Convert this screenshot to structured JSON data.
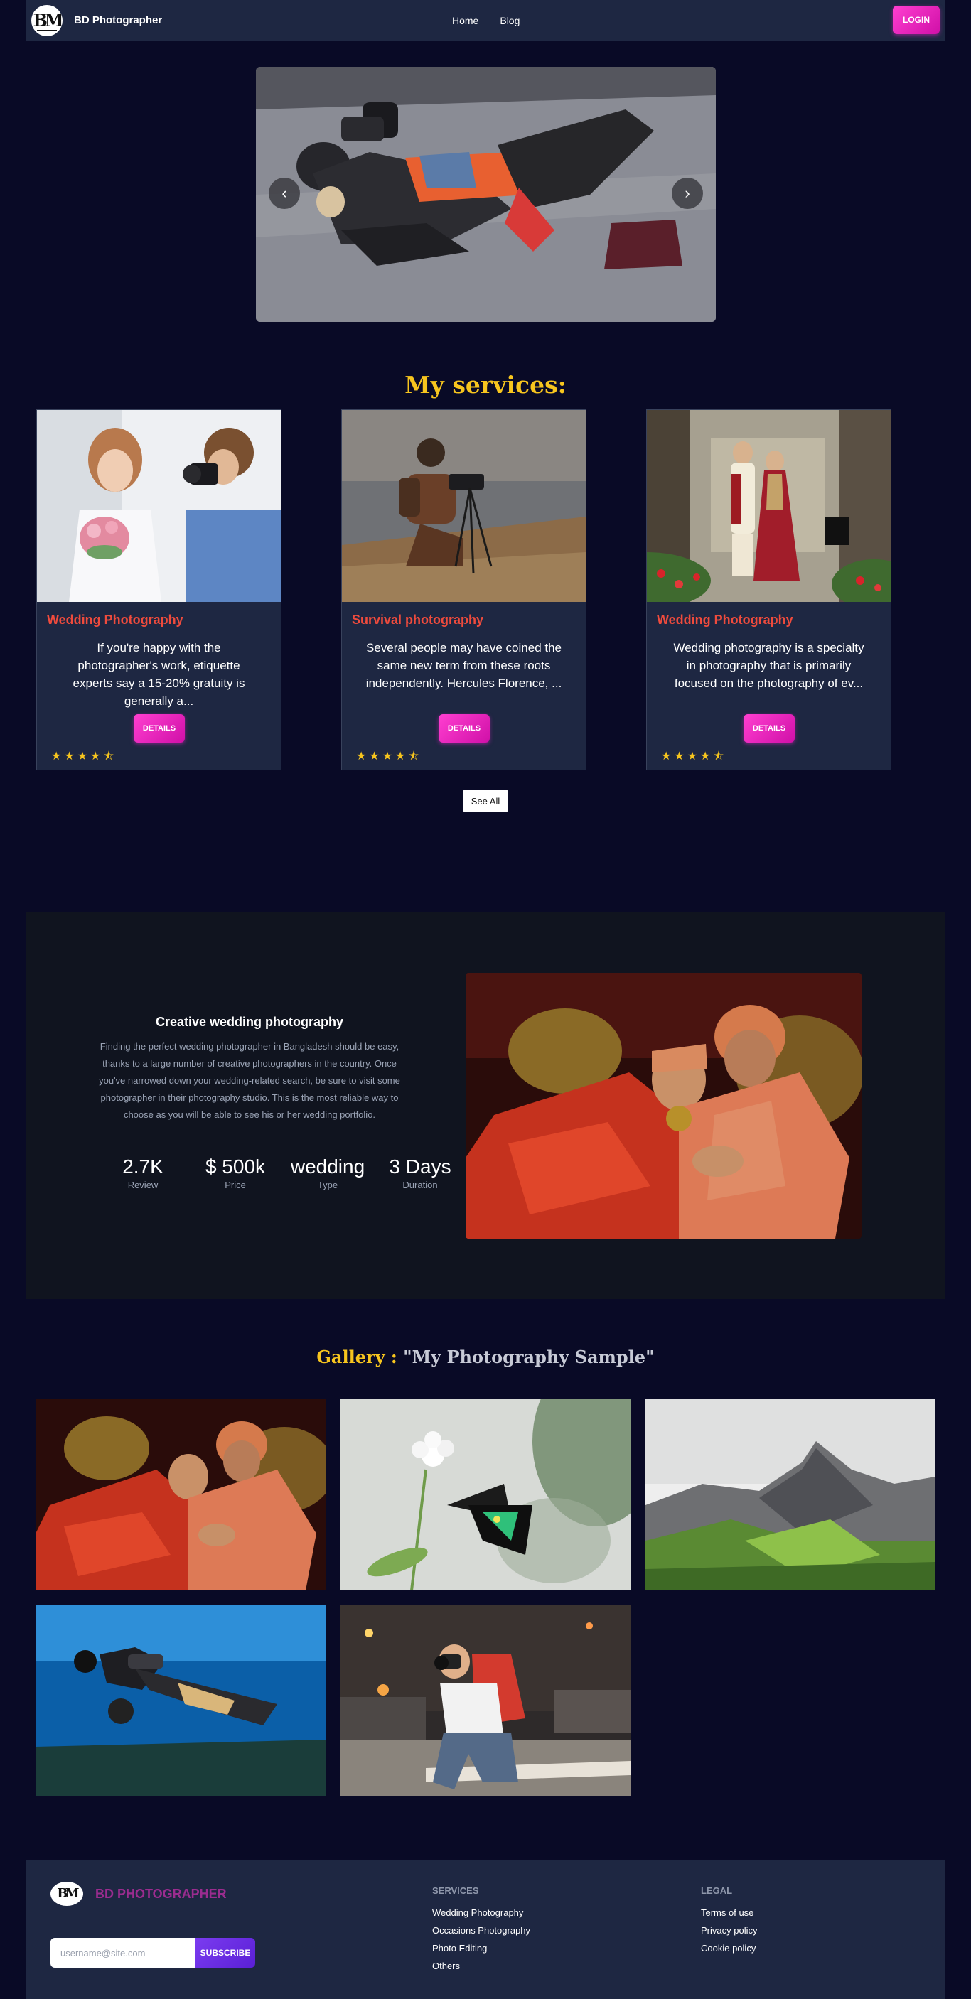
{
  "nav": {
    "brand": "BD Photographer",
    "links": [
      "Home",
      "Blog"
    ],
    "login_label": "LOGIN"
  },
  "hero": {
    "prev_label": "‹",
    "next_label": "›"
  },
  "services": {
    "title": "My services:",
    "cards": [
      {
        "title": "Wedding Photography",
        "description": "If you're happy with the photographer's work, etiquette experts say a 15-20% gratuity is generally a...",
        "button": "DETAILS",
        "rating": 4.5
      },
      {
        "title": "Survival photography",
        "description": "Several people may have coined the same new term from these roots independently. Hercules Florence, ...",
        "button": "DETAILS",
        "rating": 4.5
      },
      {
        "title": "Wedding Photography",
        "description": "Wedding photography is a specialty in photography that is primarily focused on the photography of ev...",
        "button": "DETAILS",
        "rating": 4.5
      }
    ],
    "see_all": "See All"
  },
  "feature": {
    "title": "Creative wedding photography",
    "description": "Finding the perfect wedding photographer in Bangladesh should be easy, thanks to a large number of creative photographers in the country. Once you've narrowed down your wedding-related search, be sure to visit some photographer in their photography studio. This is the most reliable way to choose as you will be able to see his or her wedding portfolio.",
    "stats": [
      {
        "value": "2.7K",
        "label": "Review"
      },
      {
        "value": "$ 500k",
        "label": "Price"
      },
      {
        "value": "wedding",
        "label": "Type"
      },
      {
        "value": "3 Days",
        "label": "Duration"
      }
    ]
  },
  "gallery": {
    "label": "Gallery :",
    "subtitle": "\"My Photography Sample\""
  },
  "footer": {
    "brand": "BD PHOTOGRAPHER",
    "subscribe_placeholder": "username@site.com",
    "subscribe_label": "SUBSCRIBE",
    "services_title": "SERVICES",
    "services_links": [
      "Wedding Photography",
      "Occasions Photography",
      "Photo Editing",
      "Others"
    ],
    "legal_title": "LEGAL",
    "legal_links": [
      "Terms of use",
      "Privacy policy",
      "Cookie policy"
    ]
  },
  "colors": {
    "background": "#090a26",
    "navbar": "#1e2742",
    "accent_pink": "#e81cbd",
    "accent_gold": "#f7c51e",
    "service_title": "#ef4b3d"
  }
}
